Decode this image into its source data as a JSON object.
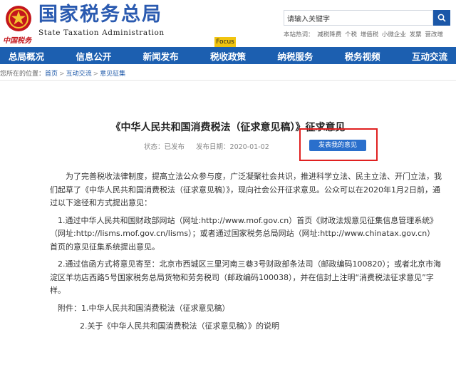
{
  "header": {
    "site_name_cn": "国家税务总局",
    "site_name_en": "State Taxation Administration",
    "china_tax_logo": "中国税务",
    "search": {
      "placeholder": "请输入关键字"
    },
    "hot_label": "本站热词：",
    "hot_words": [
      "减税降费",
      "个税",
      "增值税",
      "小微企业",
      "发票",
      "营改增"
    ]
  },
  "nav": {
    "focus_tag": "Focus",
    "items": [
      "总局概况",
      "信息公开",
      "新闻发布",
      "税收政策",
      "纳税服务",
      "税务视频",
      "互动交流"
    ]
  },
  "breadcrumb": {
    "prefix": "您所在的位置：",
    "items": [
      "首页",
      "互动交流",
      "意见征集"
    ]
  },
  "article": {
    "title": "《中华人民共和国消费税法（征求意见稿）》征求意见",
    "status": "状态：已发布",
    "date_label": "发布日期：",
    "date": "2020-01-02",
    "opinion_button": "发表我的意见",
    "paragraphs": [
      "为了完善税收法律制度，提高立法公众参与度，广泛凝聚社会共识，推进科学立法、民主立法、开门立法，我们起草了《中华人民共和国消费税法（征求意见稿）》，现向社会公开征求意见。公众可以在2020年1月2日前，通过以下途径和方式提出意见：",
      "1.通过中华人民共和国财政部网站（网址:http://www.mof.gov.cn）首页《财政法规意见征集信息管理系统》（网址:http://lisms.mof.gov.cn/lisms）；或者通过国家税务总局网站（网址:http://www.chinatax.gov.cn）首页的意见征集系统提出意见。",
      "2.通过信函方式将意见寄至：北京市西城区三里河南三巷3号财政部条法司（邮政编码100820）；或者北京市海淀区羊坊店西路5号国家税务总局货物和劳务税司（邮政编码100038），并在信封上注明“消费税法征求意见”字样。"
    ],
    "attachments": [
      "附件：1.中华人民共和国消费税法（征求意见稿）",
      "2.关于《中华人民共和国消费税法（征求意见稿）》的说明"
    ]
  },
  "colors": {
    "brand_blue": "#1c5fb0",
    "highlight_red": "#e02020",
    "focus_yellow": "#f1c40f"
  }
}
